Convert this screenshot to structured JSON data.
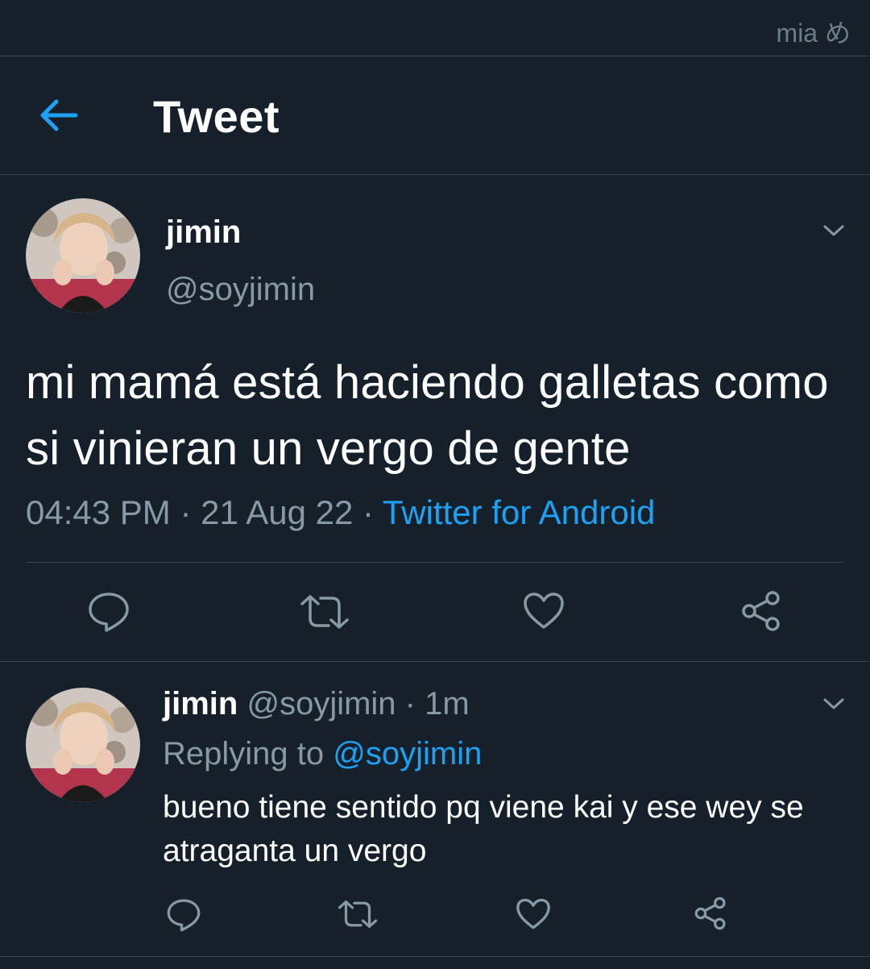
{
  "watermark": "mia め",
  "header": {
    "title": "Tweet",
    "back_icon": "arrow-left-icon"
  },
  "main_tweet": {
    "display_name": "jimin",
    "handle": "@soyjimin",
    "text": "mi mamá está haciendo galletas como si vinieran un vergo de gente",
    "time": "04:43 PM",
    "date": "21 Aug 22",
    "sep": "·",
    "source": "Twitter for Android",
    "actions": [
      "reply-icon",
      "retweet-icon",
      "like-icon",
      "share-icon"
    ]
  },
  "reply_tweet": {
    "display_name": "jimin",
    "handle": "@soyjimin",
    "sep": "·",
    "age": "1m",
    "replying_label": "Replying to",
    "replying_handle": "@soyjimin",
    "text": "bueno tiene sentido pq viene kai y ese wey se atraganta un vergo",
    "actions": [
      "reply-icon",
      "retweet-icon",
      "like-icon",
      "share-icon"
    ]
  },
  "colors": {
    "background": "#15202b",
    "divider": "#38444d",
    "muted": "#8899a6",
    "accent": "#1da1f2",
    "text": "#ffffff"
  }
}
